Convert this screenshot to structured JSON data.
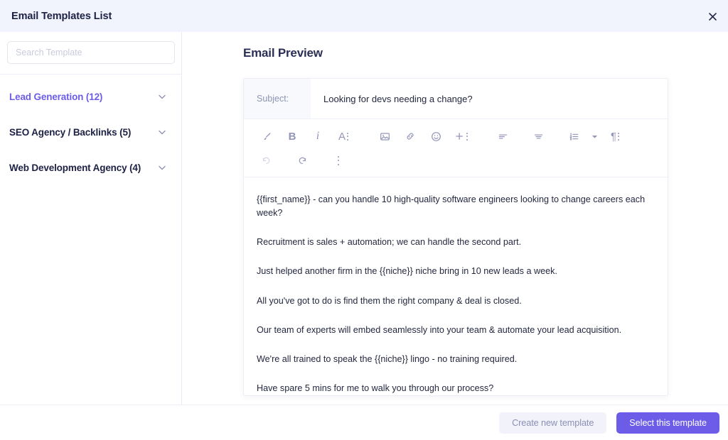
{
  "header": {
    "title": "Email Templates List",
    "close_icon": "close-icon"
  },
  "sidebar": {
    "search": {
      "placeholder": "Search Template",
      "value": ""
    },
    "categories": [
      {
        "label": "Lead Generation (12)",
        "active": true,
        "chevron": "chevron-down-icon"
      },
      {
        "label": "SEO Agency / Backlinks (5)",
        "active": false,
        "chevron": "chevron-down-icon"
      },
      {
        "label": "Web Development Agency (4)",
        "active": false,
        "chevron": "chevron-down-icon"
      }
    ]
  },
  "main": {
    "preview_title": "Email Preview",
    "subject": {
      "label": "Subject:",
      "value": "Looking for devs needing a change?"
    },
    "toolbar": {
      "row1": [
        "brush-icon",
        "bold-icon",
        "italic-icon",
        "text-style-icon",
        "image-icon",
        "link-icon",
        "emoji-icon",
        "insert-icon",
        "align-left-icon",
        "align-center-icon",
        "ordered-list-icon",
        "ordered-list-dropdown-icon",
        "paragraph-icon"
      ],
      "row2": [
        "undo-icon",
        "redo-icon",
        "more-options-icon"
      ]
    },
    "body_paragraphs": [
      "{{first_name}} - can you handle 10 high-quality software engineers looking to change careers each week?",
      "Recruitment is sales + automation; we can handle the second part.",
      "Just helped another firm in the {{niche}} niche bring in 10 new leads a week.",
      "All you've got to do is find them the right company & deal is closed.",
      "Our team of experts will embed seamlessly into your team & automate your lead acquisition.",
      "We're all trained to speak the {{niche}} lingo - no training required.",
      "Have spare 5 mins for me to walk you through our process?"
    ]
  },
  "footer": {
    "create_label": "Create new template",
    "select_label": "Select this template"
  },
  "colors": {
    "accent": "#6c5ce7",
    "header_bg": "#f2f4fd",
    "text_dark": "#1d2144",
    "muted": "#8e93b3"
  }
}
